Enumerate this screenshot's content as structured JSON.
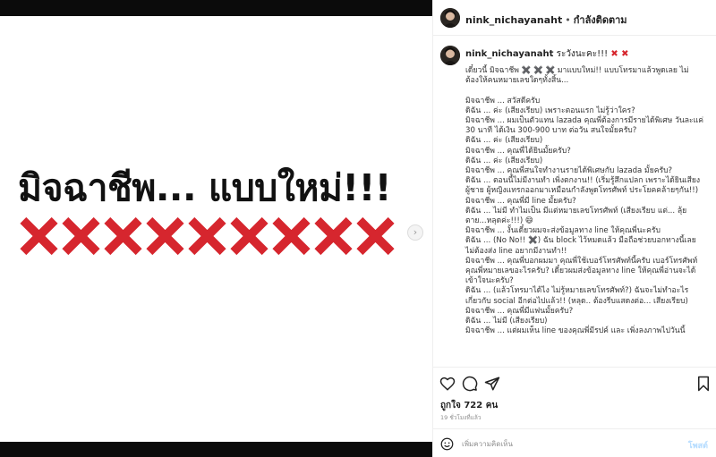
{
  "post": {
    "headline": "มิจฉาชีพ... แบบใหม่!!!",
    "x_count": 9,
    "x_color": "#d6262e",
    "next_icon": "chevron-right-icon"
  },
  "header": {
    "username": "nink_nichayanaht",
    "separator": "•",
    "follow_label": "กำลังติดตาม"
  },
  "caption": {
    "username": "nink_nichayanaht",
    "head_text": "ระวังนะคะ!!!",
    "lines": [
      "เดี๋ยวนี้ มิจฉาชีพ ✖️ ✖️ ✖️ มาแบบใหม่!! แบบโทรมาแล้วพูดเลย ไม่",
      "ต้องให้คนหมายเลขใดๆทั้งสิ้น...",
      "",
      "มิจฉาชีพ ... สวัสดีครับ",
      "ดิฉัน ... ค่ะ (เสียงเรียบ) เพราะตอนแรก ไม่รู้ว่าใคร?",
      "มิจฉาชีพ ... ผมเป็นตัวแทน lazada คุณพี่ต้องการมีรายได้พิเศษ วันละแค่",
      "30 นาที ได้เงิน 300-900 บาท ต่อวัน สนใจมั้ยครับ?",
      "ดิฉัน ... ค่ะ (เสียงเรียบ)",
      "มิจฉาชีพ ... คุณพี่ได้ยินมั้ยครับ?",
      "ดิฉัน ... ค่ะ (เสียงเรียบ)",
      "มิจฉาชีพ ... คุณพี่สนใจทำงานรายได้พิเศษกับ lazada มั้ยครับ?",
      "ดิฉัน ... ตอนนี้ไม่มีงานทำ เพิ่งตกงาน!! (เริ่มรู้สึกแปลก เพราะได้ยินเสียง",
      "ผู้ชาย ผู้หญิงแทรกออกมาเหมือนกำลังพูดโทรศัพท์ ประโยคคล้ายๆกัน!!)",
      "มิจฉาชีพ ... คุณพี่มี line มั้ยครับ?",
      "ดิฉัน ... ไม่มี ทำไมเป็น มีแต่หมายเลขโทรศัพท์ (เสียงเรียบ แต่... ลุ้ย",
      "ตาย...หลุดค่ะ!!!) 😄",
      "มิจฉาชีพ ... งั้นเดี๋ยวผมจะส่งข้อมูลทาง line ให้คุณพี่นะครับ",
      "ดิฉัน ... (No No!! ✖️) ฉัน block ไว้หมดแล้ว มือถือช่วยบอกทางนี้เลย",
      "ไม่ต้องส่ง line อยากมีงานทำ!!",
      "มิจฉาชีพ ... คุณพี่บอกผมมา คุณพี่ใช้เบอร์โทรศัพท์นี้ครับ เบอร์โทรศัพท์",
      "คุณพี่หมายเลขอะไรครับ? เดี๋ยวผมส่งข้อมูลทาง line ให้คุณพี่อ่านจะได้",
      "เข้าใจนะครับ?",
      "ดิฉัน ... (แล้วโทรมาได้ไง ไม่รู้หมายเลขโทรศัพท์?) ฉันจะไม่ทำอะไร",
      "เกี่ยวกับ social อีกต่อไปแล้ว!! (หลุด.. ต้องรีบแสดงต่อ... เสียงเรียบ)",
      "มิจฉาชีพ ... คุณพี่มีแฟนมั้ยครับ?",
      "ดิฉัน ... ไม่มี (เสียงเรียบ)",
      "มิจฉาชีพ ... แต่ผมเห็น line ของคุณพี่มีรปค์ และ เพิ่งลงภาพไปวันนี้"
    ]
  },
  "actions": {
    "like_icon": "heart-icon",
    "comment_icon": "comment-icon",
    "share_icon": "share-icon",
    "save_icon": "bookmark-icon"
  },
  "likes_text": "ถูกใจ 722 คน",
  "time_text": "19 ชั่วโมงที่แล้ว",
  "comment": {
    "placeholder": "เพิ่มความคิดเห็น",
    "post_label": "โพสต์"
  }
}
